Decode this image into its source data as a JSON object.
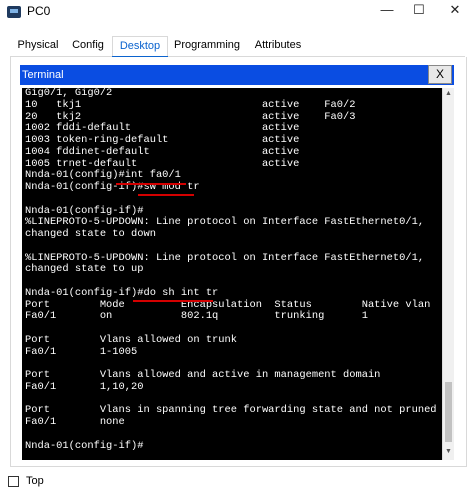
{
  "window": {
    "title": "PC0",
    "minimize_glyph": "—",
    "maximize_glyph": "☐",
    "close_glyph": "✕"
  },
  "tabs": [
    {
      "label": "Physical",
      "active": false
    },
    {
      "label": "Config",
      "active": false
    },
    {
      "label": "Desktop",
      "active": true
    },
    {
      "label": "Programming",
      "active": false
    },
    {
      "label": "Attributes",
      "active": false
    }
  ],
  "terminal": {
    "title": "Terminal",
    "close_label": "X",
    "lines": [
      "Gig0/1, Gig0/2",
      "10   tkj1                             active    Fa0/2",
      "20   tkj2                             active    Fa0/3",
      "1002 fddi-default                     active",
      "1003 token-ring-default               active",
      "1004 fddinet-default                  active",
      "1005 trnet-default                    active",
      "Nnda-01(config)#int fa0/1",
      "Nnda-01(config-if)#sw mod tr",
      "",
      "Nnda-01(config-if)#",
      "%LINEPROTO-5-UPDOWN: Line protocol on Interface FastEthernet0/1,",
      "changed state to down",
      "",
      "%LINEPROTO-5-UPDOWN: Line protocol on Interface FastEthernet0/1,",
      "changed state to up",
      "",
      "Nnda-01(config-if)#do sh int tr",
      "Port        Mode         Encapsulation  Status        Native vlan",
      "Fa0/1       on           802.1q         trunking      1",
      "",
      "Port        Vlans allowed on trunk",
      "Fa0/1       1-1005",
      "",
      "Port        Vlans allowed and active in management domain",
      "Fa0/1       1,10,20",
      "",
      "Port        Vlans in spanning tree forwarding state and not pruned",
      "Fa0/1       none",
      "",
      "Nnda-01(config-if)#"
    ],
    "scroll_up_glyph": "▲",
    "scroll_down_glyph": "▼"
  },
  "annotations": {
    "color": "#d40000"
  },
  "footer": {
    "top_label": "Top",
    "top_checked": false
  }
}
